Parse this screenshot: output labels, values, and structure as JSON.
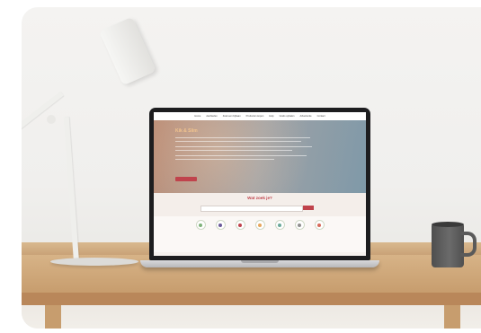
{
  "scene": {
    "objects": [
      "desk-lamp",
      "laptop",
      "mug",
      "wooden-desk"
    ]
  },
  "website": {
    "nav_items": [
      "Home",
      "Aanbieden",
      "Zoek een bijbaan",
      "Producten kopen",
      "Hulp",
      "Gratis ophalen",
      "Advertentie",
      "Contact"
    ],
    "hero_title": "Kik & Slim",
    "search_title": "Wat zoek je?"
  },
  "colors": {
    "accent": "#c0434c",
    "hero_title": "#f2c48e",
    "mug": "#5a5a5a",
    "wood": "#c99f70"
  },
  "category_icon_colors": [
    "#7fb27a",
    "#6a5a9a",
    "#c0434c",
    "#e7a65b",
    "#6aa89a",
    "#8f8f8f",
    "#d66a5a"
  ]
}
